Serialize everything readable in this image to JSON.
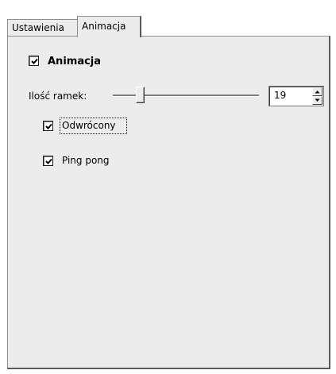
{
  "tabs": [
    {
      "label": "Ustawienia",
      "active": false
    },
    {
      "label": "Animacja",
      "active": true
    }
  ],
  "animation": {
    "enabled_label": "Animacja",
    "enabled_checked": true,
    "frames_label": "Ilość ramek:",
    "frames_value": "19",
    "slider_icon": "slider-thumb",
    "reversed_label": "Odwrócony",
    "reversed_checked": true,
    "pingpong_label": "Ping pong",
    "pingpong_checked": true
  },
  "colors": {
    "panel_bg": "#ececec",
    "border_dark": "#5b5b5b",
    "border_light": "#8e8e8e"
  }
}
